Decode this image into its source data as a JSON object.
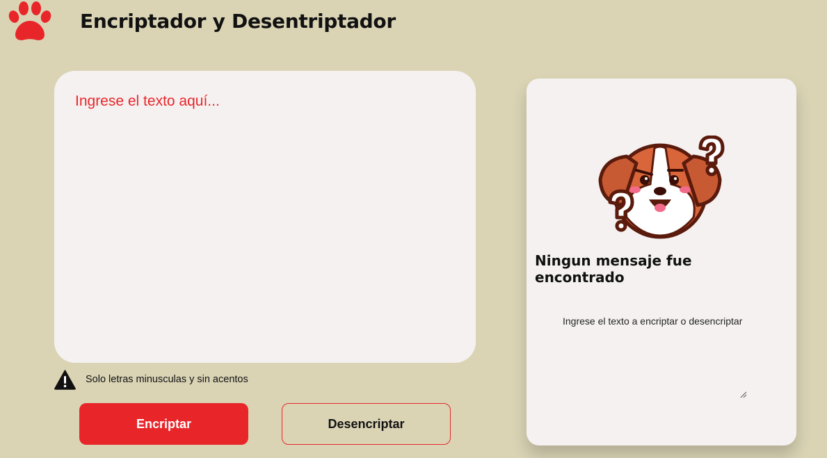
{
  "header": {
    "logo_icon": "paw-icon",
    "title": "Encriptador y Desentriptador"
  },
  "input": {
    "placeholder": "Ingrese el texto aquí...",
    "value": ""
  },
  "warning": {
    "icon": "warning-icon",
    "text": "Solo letras minusculas y sin acentos"
  },
  "buttons": {
    "encrypt_label": "Encriptar",
    "decrypt_label": "Desencriptar"
  },
  "output": {
    "illustration": "confused-dog-icon",
    "title": "Ningun mensaje fue encontrado",
    "subtitle": "Ingrese el texto a encriptar o desencriptar"
  },
  "colors": {
    "background": "#dad4b5",
    "accent": "#e8262a",
    "card": "#f5f1f1"
  }
}
